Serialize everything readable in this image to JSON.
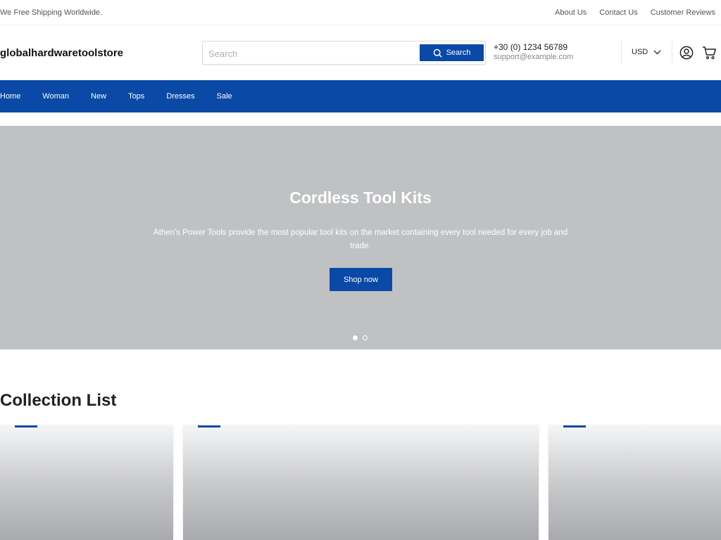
{
  "topbar": {
    "shipping_text": "We Free Shipping Worldwide.",
    "links": [
      "About Us",
      "Contact Us",
      "Customer Reviews"
    ]
  },
  "header": {
    "logo": "globalhardwaretoolstore",
    "search_placeholder": "Search",
    "search_button": "Search",
    "phone": "+30 (0) 1234 56789",
    "email": "support@example.com",
    "currency": "USD"
  },
  "nav": {
    "items": [
      "Home",
      "Woman",
      "New",
      "Tops",
      "Dresses",
      "Sale"
    ]
  },
  "hero": {
    "title": "Cordless Tool Kits",
    "text": "Athen's Power Tools provide the most popular tool kits on the market containing every tool needed for every job and trade.",
    "button": "Shop now",
    "slide_count": 2,
    "active_slide": 1
  },
  "collection": {
    "title": "Collection List"
  },
  "colors": {
    "accent": "#0a4aa6",
    "hero_bg": "#bfc1c3"
  },
  "icons": {
    "search": "search-icon",
    "chevron": "chevron-down-icon",
    "account": "user-icon",
    "cart": "cart-icon"
  }
}
